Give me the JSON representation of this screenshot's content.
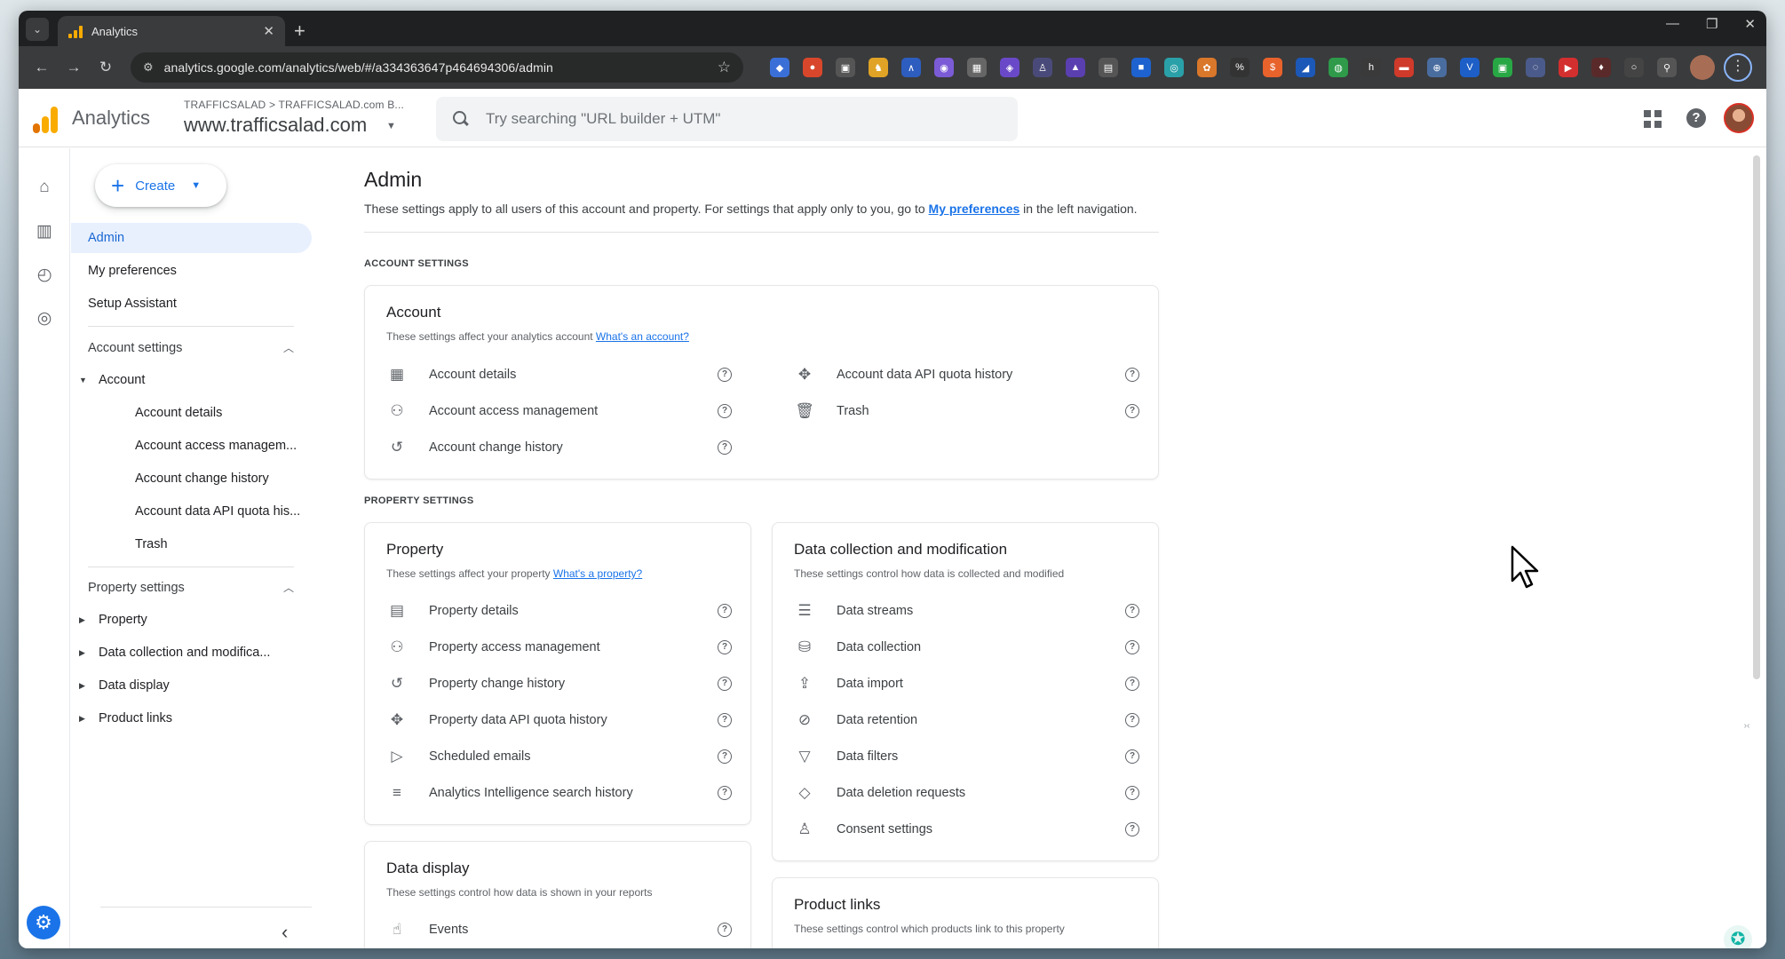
{
  "browser": {
    "tab_title": "Analytics",
    "tab_close": "✕",
    "new_tab": "+",
    "url": "analytics.google.com/analytics/web/#/a334363647p464694306/admin",
    "window_controls": [
      "—",
      "❐",
      "✕"
    ]
  },
  "header": {
    "app_name": "Analytics",
    "breadcrumb": "TRAFFICSALAD  >  TRAFFICSALAD.com B...",
    "property": "www.trafficsalad.com",
    "search_placeholder": "Try searching \"URL builder + UTM\""
  },
  "sidebar": {
    "create_label": "Create",
    "nav": [
      {
        "label": "Admin",
        "active": true
      },
      {
        "label": "My preferences"
      },
      {
        "label": "Setup Assistant"
      }
    ],
    "account_settings": {
      "title": "Account settings",
      "group": "Account",
      "items": [
        "Account details",
        "Account access managem...",
        "Account change history",
        "Account data API quota his...",
        "Trash"
      ]
    },
    "property_settings": {
      "title": "Property settings",
      "items": [
        "Property",
        "Data collection and modifica...",
        "Data display",
        "Product links"
      ]
    }
  },
  "main": {
    "title": "Admin",
    "description_prefix": "These settings apply to all users of this account and property. For settings that apply only to you, go to ",
    "description_link": "My preferences",
    "description_suffix": " in the left navigation.",
    "account_section_label": "ACCOUNT SETTINGS",
    "property_section_label": "PROPERTY SETTINGS",
    "account_card": {
      "title": "Account",
      "subtitle": "These settings affect your analytics account ",
      "link": "What's an account?",
      "left_items": [
        {
          "label": "Account details",
          "icon": "building-icon"
        },
        {
          "label": "Account access management",
          "icon": "people-icon"
        },
        {
          "label": "Account change history",
          "icon": "history-icon"
        }
      ],
      "right_items": [
        {
          "label": "Account data API quota history",
          "icon": "api-icon"
        },
        {
          "label": "Trash",
          "icon": "trash-icon"
        }
      ]
    },
    "property_card": {
      "title": "Property",
      "subtitle": "These settings affect your property ",
      "link": "What's a property?",
      "items": [
        {
          "label": "Property details",
          "icon": "card-icon"
        },
        {
          "label": "Property access management",
          "icon": "people-icon"
        },
        {
          "label": "Property change history",
          "icon": "history-icon"
        },
        {
          "label": "Property data API quota history",
          "icon": "api-icon"
        },
        {
          "label": "Scheduled emails",
          "icon": "scheduled-email-icon"
        },
        {
          "label": "Analytics Intelligence search history",
          "icon": "search-history-icon"
        }
      ]
    },
    "data_collection_card": {
      "title": "Data collection and modification",
      "subtitle": "These settings control how data is collected and modified",
      "items": [
        {
          "label": "Data streams",
          "icon": "streams-icon"
        },
        {
          "label": "Data collection",
          "icon": "database-icon"
        },
        {
          "label": "Data import",
          "icon": "upload-icon"
        },
        {
          "label": "Data retention",
          "icon": "retention-icon"
        },
        {
          "label": "Data filters",
          "icon": "filter-icon"
        },
        {
          "label": "Data deletion requests",
          "icon": "eraser-icon"
        },
        {
          "label": "Consent settings",
          "icon": "consent-icon"
        }
      ]
    },
    "data_display_card": {
      "title": "Data display",
      "subtitle": "These settings control how data is shown in your reports",
      "items": [
        {
          "label": "Events",
          "icon": "touch-icon"
        }
      ]
    },
    "product_links_card": {
      "title": "Product links",
      "subtitle": "These settings control which products link to this property"
    }
  }
}
